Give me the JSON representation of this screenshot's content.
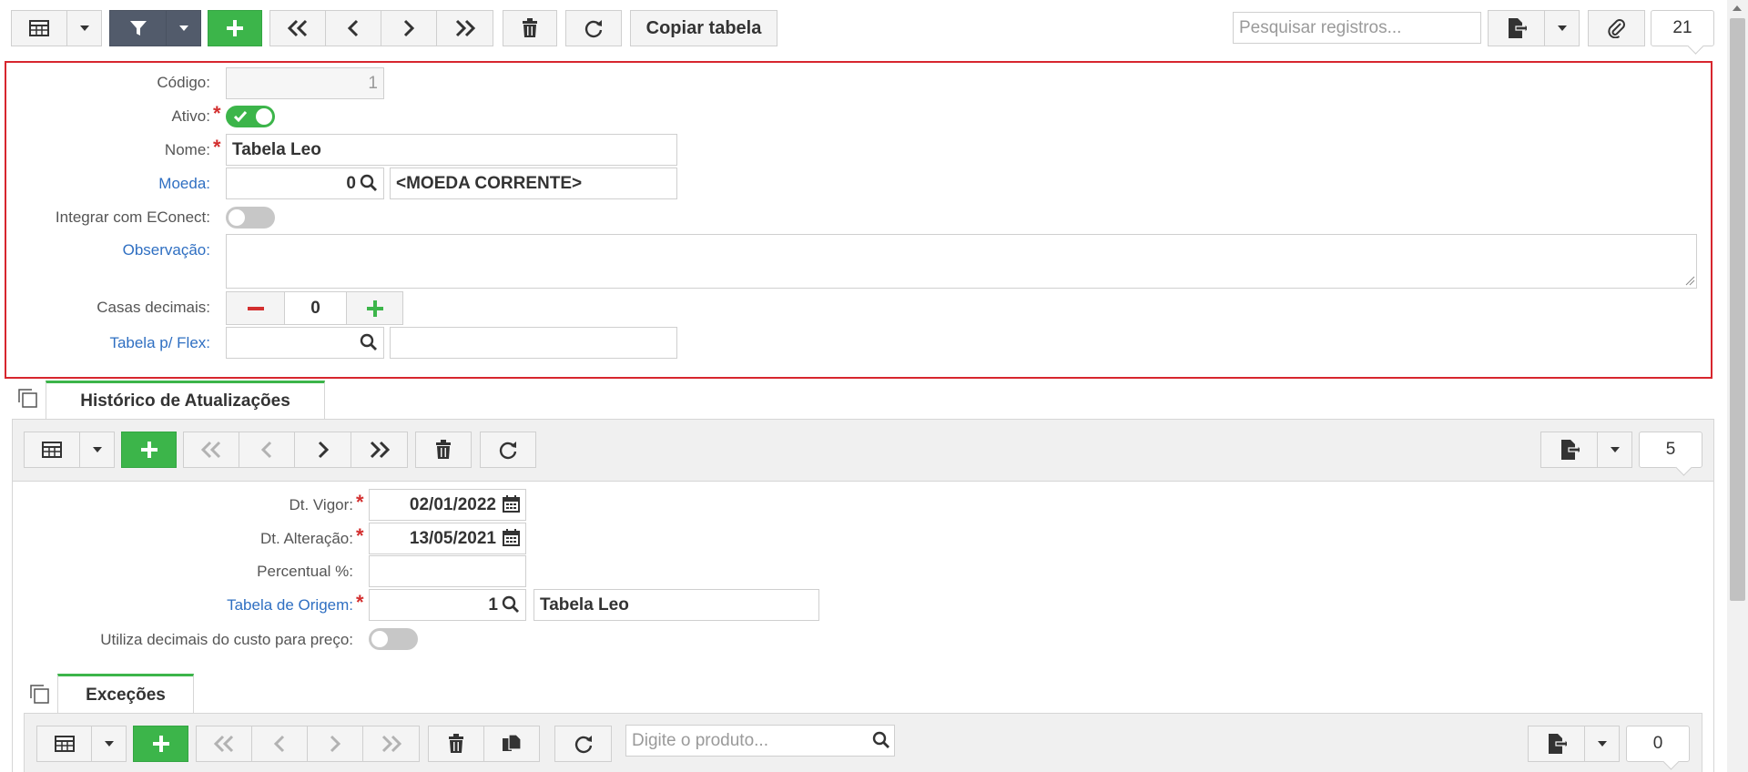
{
  "toolbar": {
    "copy_label": "Copiar tabela",
    "search_placeholder": "Pesquisar registros...",
    "record_count": "21"
  },
  "form": {
    "codigo_label": "Código:",
    "codigo_value": "1",
    "ativo_label": "Ativo:",
    "ativo_on": true,
    "nome_label": "Nome:",
    "nome_value": "Tabela Leo",
    "moeda_label": "Moeda:",
    "moeda_code": "0",
    "moeda_desc": "<MOEDA CORRENTE>",
    "econect_label": "Integrar com EConect:",
    "econect_on": false,
    "observacao_label": "Observação:",
    "observacao_value": "",
    "casas_label": "Casas decimais:",
    "casas_value": "0",
    "flex_label": "Tabela p/ Flex:",
    "flex_code": "",
    "flex_desc": ""
  },
  "historico": {
    "tab_label": "Histórico de Atualizações",
    "record_count": "5",
    "dt_vigor_label": "Dt. Vigor:",
    "dt_vigor_value": "02/01/2022",
    "dt_alteracao_label": "Dt. Alteração:",
    "dt_alteracao_value": "13/05/2021",
    "percentual_label": "Percentual %:",
    "percentual_value": "",
    "origem_label": "Tabela de Origem:",
    "origem_code": "1",
    "origem_desc": "Tabela Leo",
    "decimais_label": "Utiliza decimais do custo para preço:",
    "decimais_on": false
  },
  "excecoes": {
    "tab_label": "Exceções",
    "search_placeholder": "Digite o produto...",
    "record_count": "0"
  },
  "colors": {
    "accent_green": "#3cb54a",
    "highlight_red": "#d7262e",
    "link_blue": "#2f6fc2",
    "dark_button": "#525b6b"
  }
}
